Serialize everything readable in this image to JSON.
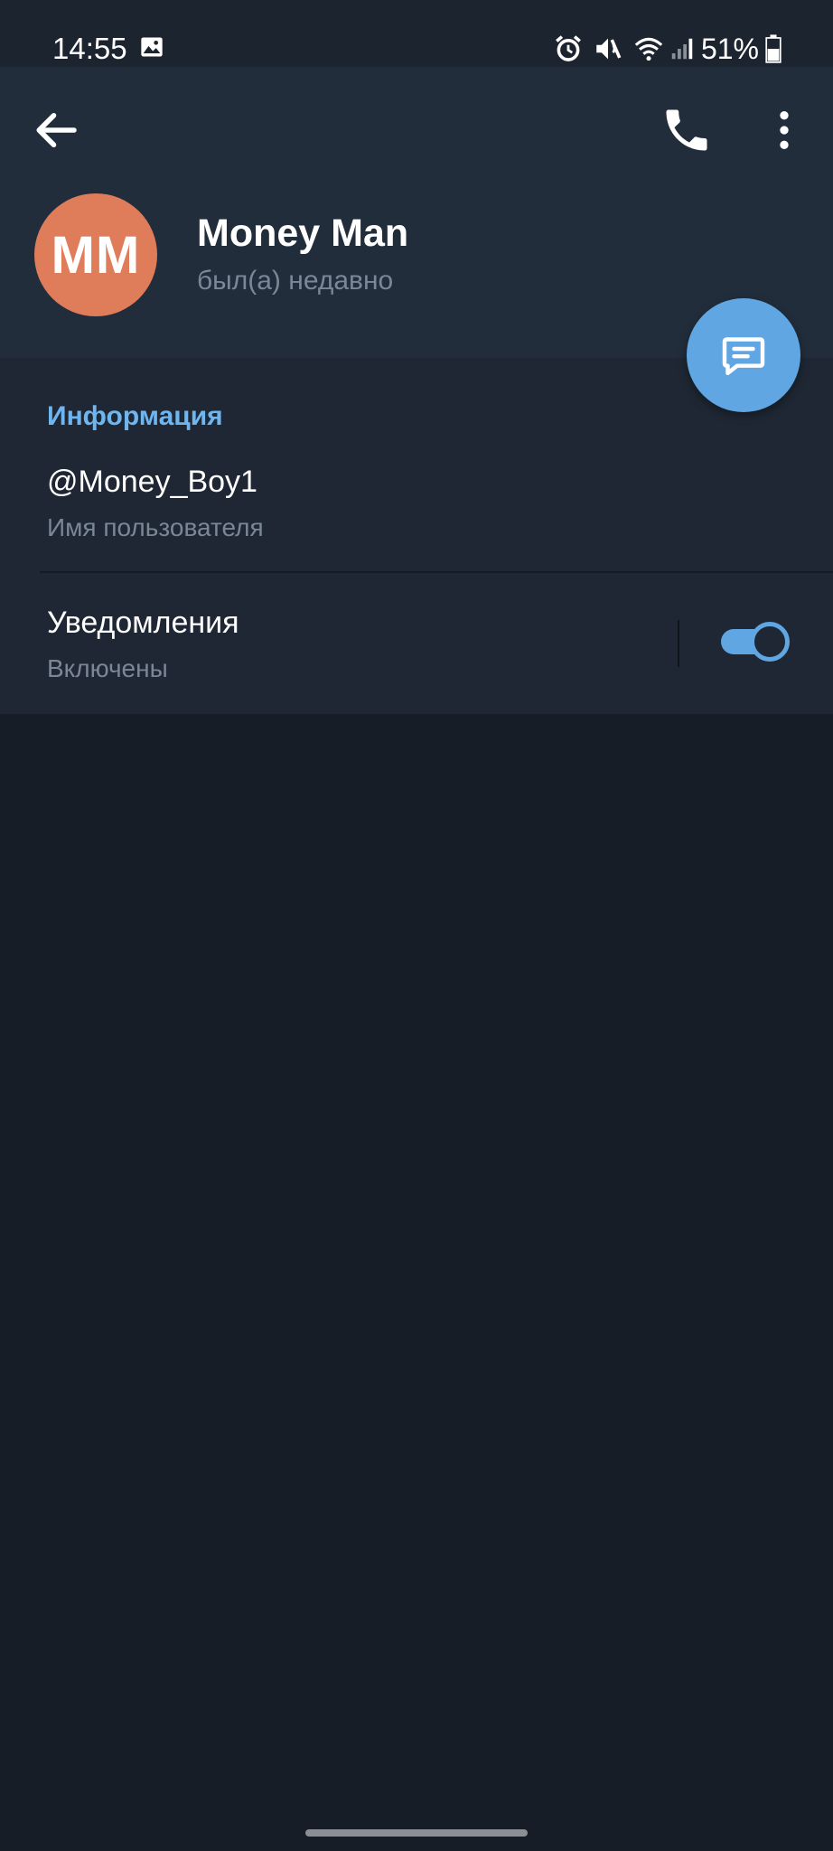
{
  "status_bar": {
    "time": "14:55",
    "battery_percent": "51%",
    "icons": [
      "gallery-icon",
      "alarm-icon",
      "mute-icon",
      "wifi-icon",
      "signal-icon",
      "battery-icon"
    ]
  },
  "toolbar": {
    "back_icon": "arrow-left-icon",
    "call_icon": "phone-icon",
    "more_icon": "more-vertical-icon"
  },
  "profile": {
    "initials": "MM",
    "name": "Money Man",
    "status": "был(а) недавно",
    "avatar_color": "#df7d5b"
  },
  "fab": {
    "icon": "message-icon",
    "color": "#5fa6e3"
  },
  "info": {
    "section_title": "Информация",
    "username": "@Money_Boy1",
    "username_label": "Имя пользователя",
    "notifications_title": "Уведомления",
    "notifications_status": "Включены",
    "notifications_enabled": true
  },
  "colors": {
    "accent": "#5fa6e3",
    "section_title": "#6fb5ef",
    "header_bg": "#212d3b",
    "page_bg": "#171d26"
  }
}
